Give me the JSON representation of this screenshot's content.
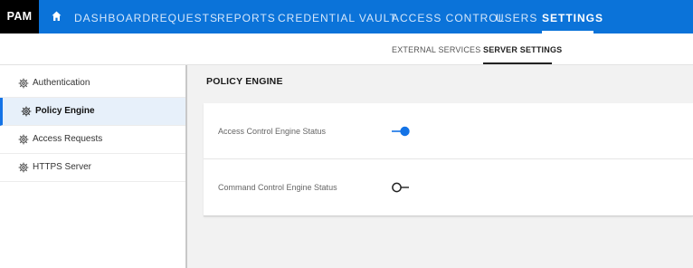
{
  "app": {
    "logo": "PAM"
  },
  "nav": {
    "items": [
      {
        "label": "DASHBOARD"
      },
      {
        "label": "REQUESTS"
      },
      {
        "label": "REPORTS"
      },
      {
        "label": "CREDENTIAL VAULT"
      },
      {
        "label": "ACCESS CONTROL"
      },
      {
        "label": "USERS"
      },
      {
        "label": "SETTINGS",
        "active": true
      }
    ]
  },
  "subtabs": {
    "items": [
      {
        "label": "EXTERNAL SERVICES"
      },
      {
        "label": "SERVER SETTINGS",
        "active": true
      }
    ]
  },
  "sidebar": {
    "items": [
      {
        "label": "Authentication",
        "icon": "gear-icon"
      },
      {
        "label": "Policy Engine",
        "icon": "gear-icon",
        "active": true
      },
      {
        "label": "Access Requests",
        "icon": "gear-icon"
      },
      {
        "label": "HTTPS Server",
        "icon": "gear-icon"
      }
    ]
  },
  "main": {
    "title": "POLICY ENGINE",
    "settings": [
      {
        "label": "Access Control Engine Status",
        "enabled": true
      },
      {
        "label": "Command Control Engine Status",
        "enabled": false
      }
    ]
  },
  "colors": {
    "nav_bg": "#0b73d9",
    "logo_bg": "#000000",
    "toggle_on": "#1473e6",
    "active_item_bg": "#e7f0fa"
  }
}
